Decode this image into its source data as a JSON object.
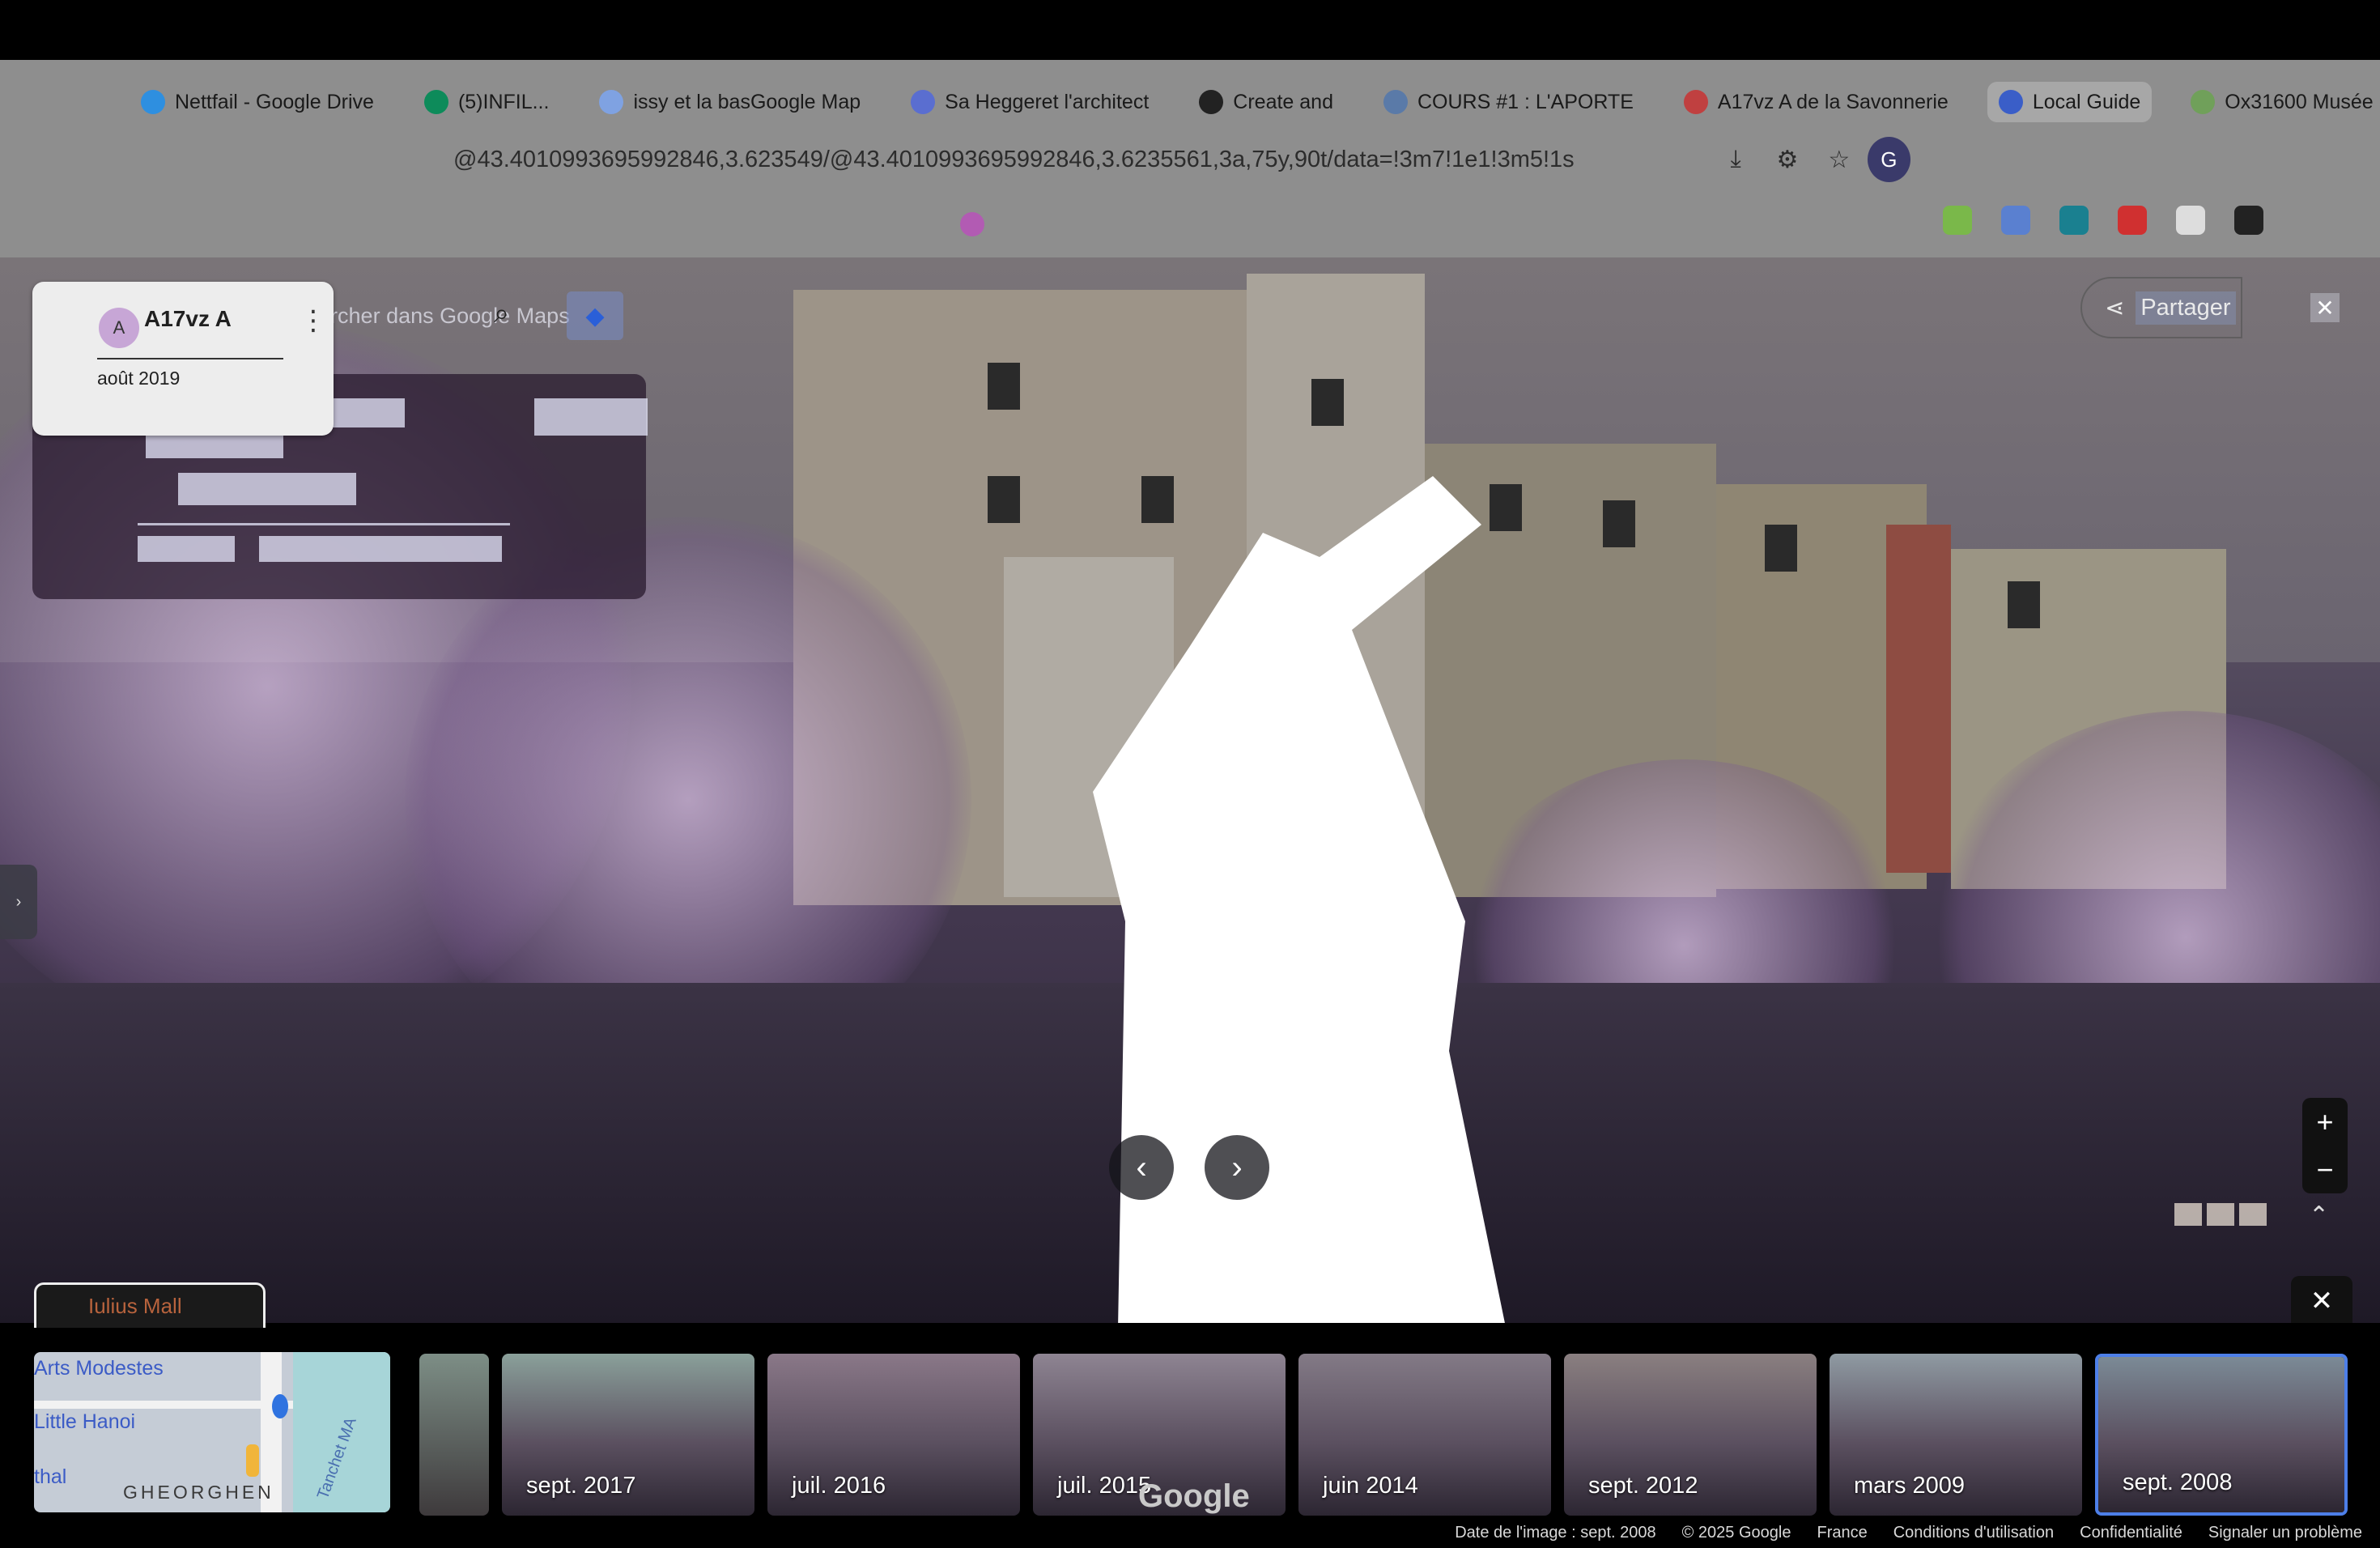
{
  "browser": {
    "tabs": [
      {
        "label": "Nettfail - Google Drive",
        "fav_color": "#2e8fe0"
      },
      {
        "label": "(5)INFIL...",
        "fav_color": "#0d8b5a"
      },
      {
        "label": "issy et la basGoogle Map",
        "fav_color": "#7fa2e2"
      },
      {
        "label": "Sa Heggeret l'architect",
        "fav_color": "#5a6ed0"
      },
      {
        "label": "Create and",
        "fav_color": "#222222"
      },
      {
        "label": "COURS #1 : L'APORTE",
        "fav_color": "#5a7aa8"
      },
      {
        "label": "A17vz A de la Savonnerie",
        "fav_color": "#c04040"
      },
      {
        "label": "Local Guide",
        "fav_color": "#3a5ec8"
      },
      {
        "label": "Ox31600 Musée Rodin",
        "fav_color": "#70a05a"
      }
    ],
    "url": "@43.4010993695992846,3.623549/@43.4010993695992846,3.6235561,3a,75y,90t/data=!3m7!1e1!3m5!1s",
    "address_icons": [
      "download-icon",
      "extensions-icon",
      "star-icon"
    ],
    "profile_initial": "G",
    "extension_colors": [
      "#7ab84a",
      "#5a80d0",
      "#1a8090",
      "#d03030",
      "#dddddd",
      "#222222"
    ]
  },
  "info_card": {
    "name": "A17vz A",
    "date": "août 2019",
    "avatar_glyph": "A"
  },
  "search": {
    "placeholder": "Rechercher dans Google Maps"
  },
  "share": {
    "label": "Partager"
  },
  "street_view": {
    "signs": [
      "Les Deux Ramiers",
      "BAR GLACIER",
      "Restaurant",
      "L'AMIRAL"
    ]
  },
  "map": {
    "mall_label": "Iulius Mall",
    "labels": [
      "Arts Modestes",
      "Little Hanoi",
      "thal"
    ],
    "street_label": "GHEORGHEN",
    "street_side": "Tanchet MA"
  },
  "timeline": {
    "items": [
      {
        "label": "sept. 2017",
        "tint": "#8aa09a"
      },
      {
        "label": "juil. 2016",
        "tint": "#8a7888"
      },
      {
        "label": "juil. 2015",
        "tint": "#8e8492"
      },
      {
        "label": "juin 2014",
        "tint": "#837a86"
      },
      {
        "label": "sept. 2012",
        "tint": "#8a7f80"
      },
      {
        "label": "mars 2009",
        "tint": "#8f9aa2"
      },
      {
        "label": "sept. 2008",
        "tint": "#7b8a96"
      }
    ],
    "partial_tint": "#7d8e86"
  },
  "google_logo": "Google",
  "footer": {
    "items": [
      "Date de l'image : sept. 2008",
      "© 2025 Google",
      "France",
      "Conditions d'utilisation",
      "Confidentialité",
      "Signaler un problème"
    ]
  }
}
